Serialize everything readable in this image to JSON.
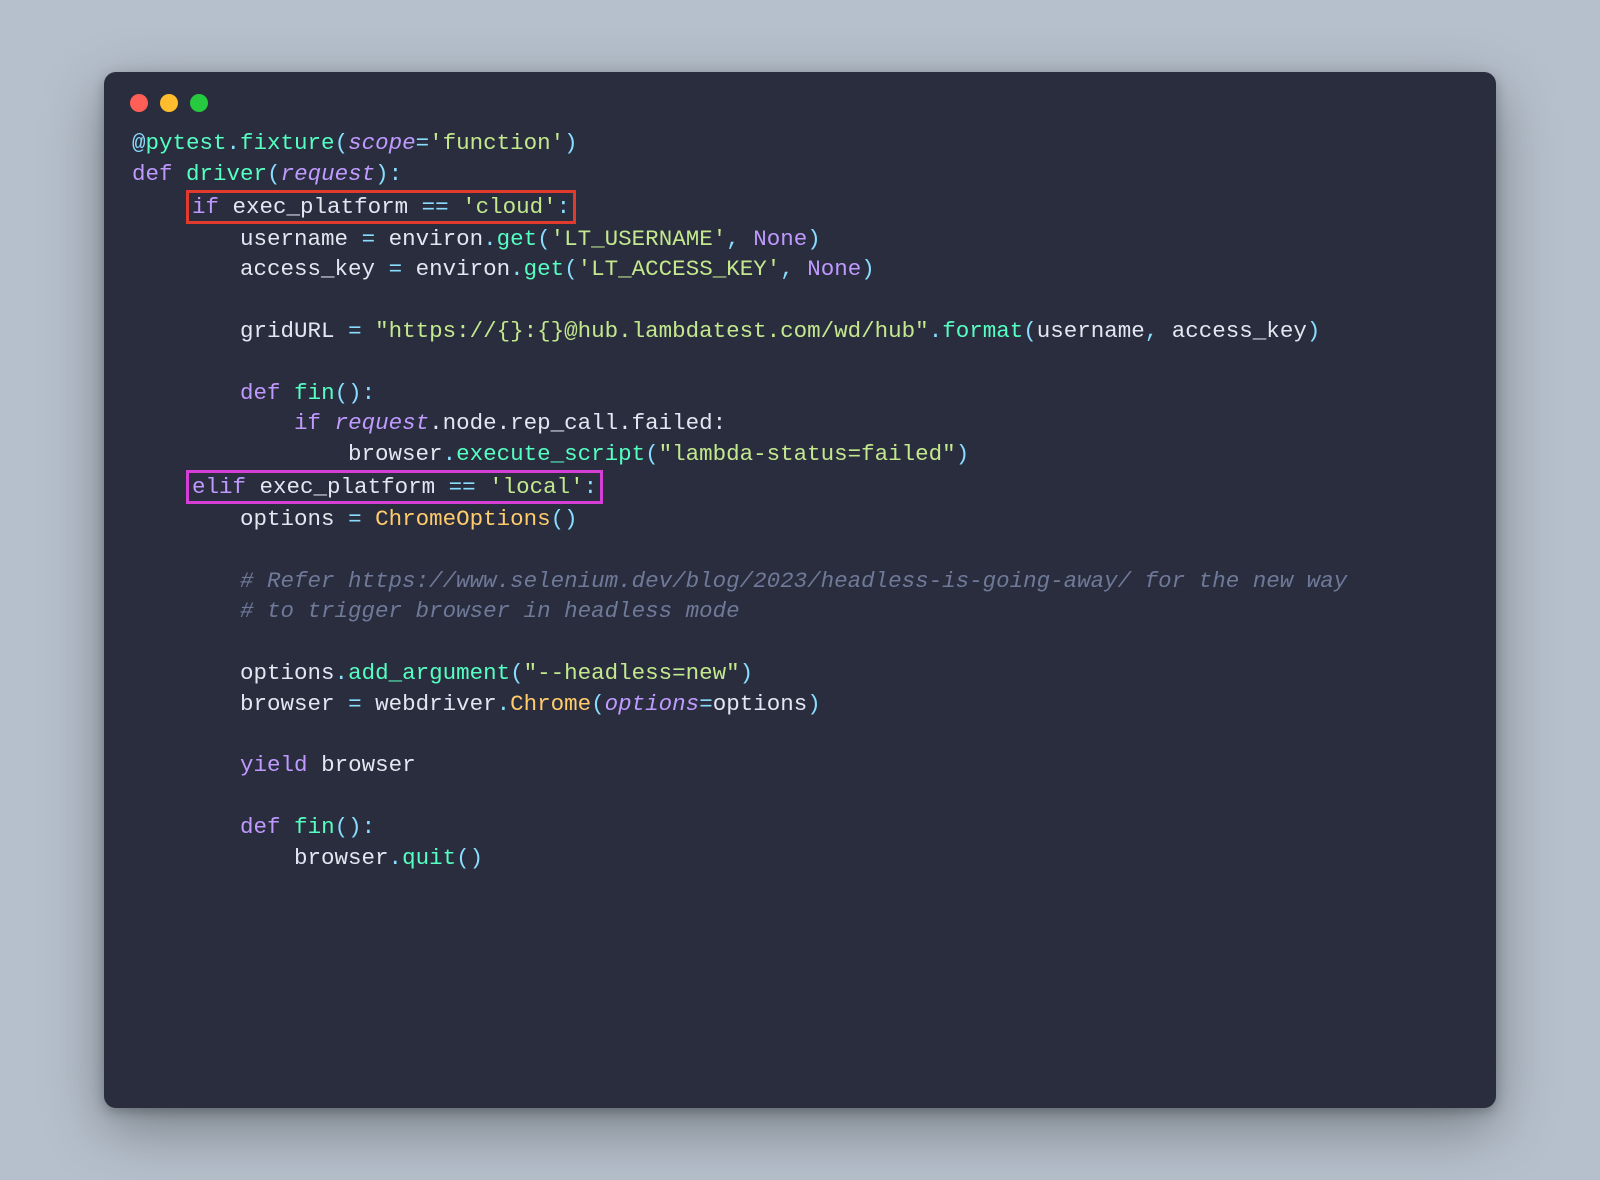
{
  "decorator": {
    "at": "@",
    "module": "pytest",
    "dot": ".",
    "func": "fixture",
    "lpar": "(",
    "kw": "scope",
    "eq": "=",
    "val": "'function'",
    "rpar": ")"
  },
  "l2": {
    "def": "def",
    "name": "driver",
    "lpar": "(",
    "arg": "request",
    "rparcolon": "):"
  },
  "l3": {
    "if": "if",
    "var": "exec_platform",
    "op": "==",
    "val": "'cloud'",
    "colon": ":"
  },
  "l4": {
    "lhs": "username",
    "eq": "=",
    "obj": "environ",
    "dot": ".",
    "call": "get",
    "lpar": "(",
    "s1": "'LT_USERNAME'",
    "comma": ",",
    "sp": " ",
    "none": "None",
    "rpar": ")"
  },
  "l5": {
    "lhs": "access_key",
    "eq": "=",
    "obj": "environ",
    "dot": ".",
    "call": "get",
    "lpar": "(",
    "s1": "'LT_ACCESS_KEY'",
    "comma": ",",
    "sp": " ",
    "none": "None",
    "rpar": ")"
  },
  "l7": {
    "lhs": "gridURL",
    "eq": "=",
    "s1": "\"https://{}:{}@hub.lambdatest.com/wd/hub\"",
    "dot": ".",
    "call": "format",
    "lpar": "(",
    "a1": "username",
    "comma": ",",
    "sp": " ",
    "a2": "access_key",
    "rpar": ")"
  },
  "l9": {
    "def": "def",
    "name": "fin",
    "parencolon": "():"
  },
  "l10": {
    "if": "if",
    "req": "request",
    "chain": ".node.rep_call.failed:"
  },
  "l11": {
    "obj": "browser",
    "dot": ".",
    "call": "execute_script",
    "lpar": "(",
    "s1": "\"lambda-status=failed\"",
    "rpar": ")"
  },
  "l12": {
    "elif": "elif",
    "var": "exec_platform",
    "op": "==",
    "val": "'local'",
    "colon": ":"
  },
  "l13": {
    "lhs": "options",
    "eq": "=",
    "cls": "ChromeOptions",
    "paren": "()"
  },
  "l15": {
    "c": "# Refer https://www.selenium.dev/blog/2023/headless-is-going-away/ for the new way"
  },
  "l16": {
    "c": "# to trigger browser in headless mode"
  },
  "l18": {
    "obj": "options",
    "dot": ".",
    "call": "add_argument",
    "lpar": "(",
    "s1": "\"--headless=new\"",
    "rpar": ")"
  },
  "l19": {
    "lhs": "browser",
    "eq": "=",
    "obj": "webdriver",
    "dot": ".",
    "cls": "Chrome",
    "lpar": "(",
    "kw": "options",
    "eq2": "=",
    "val": "options",
    "rpar": ")"
  },
  "l21": {
    "yield": "yield",
    "val": "browser"
  },
  "l23": {
    "def": "def",
    "name": "fin",
    "parencolon": "():"
  },
  "l24": {
    "obj": "browser",
    "dot": ".",
    "call": "quit",
    "paren": "()"
  }
}
